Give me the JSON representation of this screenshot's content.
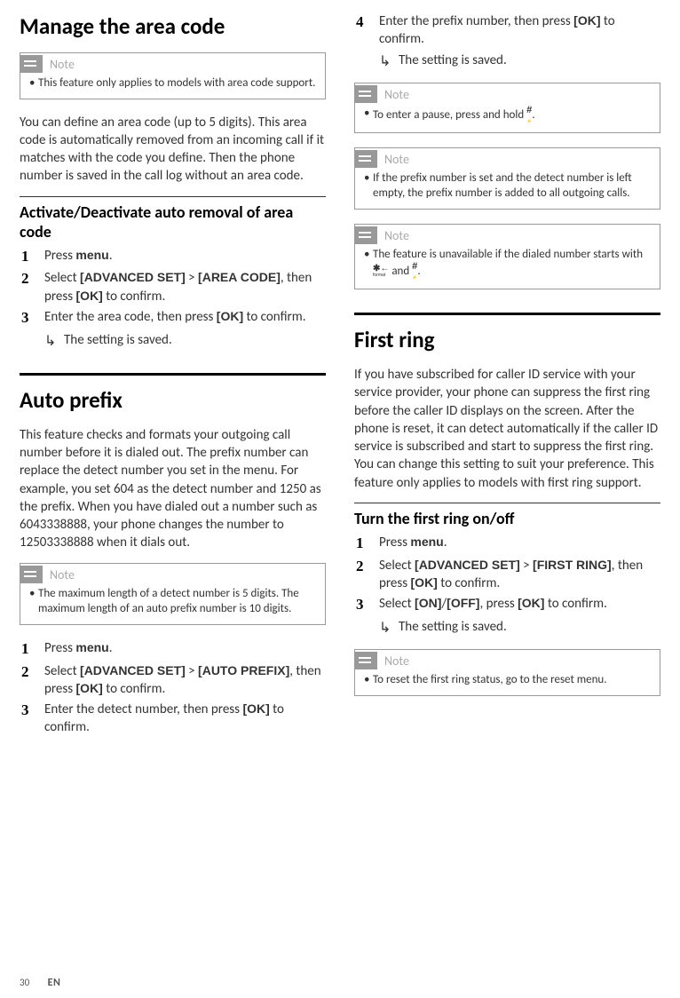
{
  "section_manage": {
    "title": "Manage the area code",
    "note1": {
      "label": "Note",
      "item1": "This feature only applies to models with area code support."
    },
    "intro": "You can define an area code (up to 5 digits). This area code is automatically removed from an incoming call if it matches with the code you define. Then the phone number is saved in the call log without an area code.",
    "sub_heading": "Activate/Deactivate auto removal of area code",
    "steps": {
      "n1": "1",
      "s1_a": "Press ",
      "s1_b": "menu",
      "s1_c": ".",
      "n2": "2",
      "s2_a": "Select ",
      "s2_b": "[ADVANCED SET]",
      "s2_c": " > ",
      "s2_d": "[AREA CODE]",
      "s2_e": ", then press ",
      "s2_f": "[OK]",
      "s2_g": " to confirm.",
      "n3": "3",
      "s3_a": "Enter the area code, then press ",
      "s3_b": "[OK]",
      "s3_c": " to confirm.",
      "sub1": "The setting is saved."
    }
  },
  "section_prefix": {
    "title": "Auto prefix",
    "intro": "This feature checks and formats your outgoing call number before it is dialed out. The prefix number can replace the detect number you set in the menu. For example, you set 604 as the detect number and 1250 as the prefix. When you have dialed out a number such as 6043338888, your phone changes the number to 12503338888 when it dials out.",
    "note1": {
      "label": "Note",
      "item1": "The maximum length of a detect number is 5 digits. The maximum length of an auto prefix number is 10 digits."
    },
    "steps": {
      "n1": "1",
      "s1_a": "Press ",
      "s1_b": "menu",
      "s1_c": ".",
      "n2": "2",
      "s2_a": "Select ",
      "s2_b": "[ADVANCED SET]",
      "s2_c": " > ",
      "s2_d": "[AUTO PREFIX]",
      "s2_e": ", then press ",
      "s2_f": "[OK]",
      "s2_g": " to confirm.",
      "n3": "3",
      "s3_a": "Enter the detect number, then press ",
      "s3_b": "[OK]",
      "s3_c": " to confirm.",
      "n4": "4",
      "s4_a": "Enter the prefix number, then press ",
      "s4_b": "[OK]",
      "s4_c": " to confirm.",
      "sub1": "The setting is saved."
    },
    "note2": {
      "label": "Note",
      "item1_a": "To enter a pause, press and hold ",
      "item1_b": "."
    },
    "note3": {
      "label": "Note",
      "item1": "If the prefix number is set and the detect number is left empty, the prefix number is added to all outgoing calls."
    },
    "note4": {
      "label": "Note",
      "item1_a": "The feature is unavailable if the dialed number starts with ",
      "item1_b": " and ",
      "item1_c": "."
    }
  },
  "section_firstring": {
    "title": "First ring",
    "intro": "If you have subscribed for caller ID service with your service provider, your phone can suppress the first ring before the caller ID displays on the screen. After the phone is reset, it can detect automatically if the caller ID service is subscribed and start to suppress the first ring. You can change this setting to suit your preference. This feature only applies to models with first ring support.",
    "sub_heading": "Turn the first ring on/off",
    "steps": {
      "n1": "1",
      "s1_a": "Press ",
      "s1_b": "menu",
      "s1_c": ".",
      "n2": "2",
      "s2_a": "Select ",
      "s2_b": "[ADVANCED SET]",
      "s2_c": " > ",
      "s2_d": "[FIRST RING]",
      "s2_e": ", then press ",
      "s2_f": "[OK]",
      "s2_g": " to confirm.",
      "n3": "3",
      "s3_a": "Select ",
      "s3_b": "[ON]",
      "s3_c": "/",
      "s3_d": "[OFF]",
      "s3_e": ", press ",
      "s3_f": "[OK]",
      "s3_g": " to confirm.",
      "sub1": "The setting is saved."
    },
    "note1": {
      "label": "Note",
      "item1": "To reset the first ring status, go to the reset menu."
    }
  },
  "footer": {
    "page": "30",
    "lang": "EN"
  }
}
